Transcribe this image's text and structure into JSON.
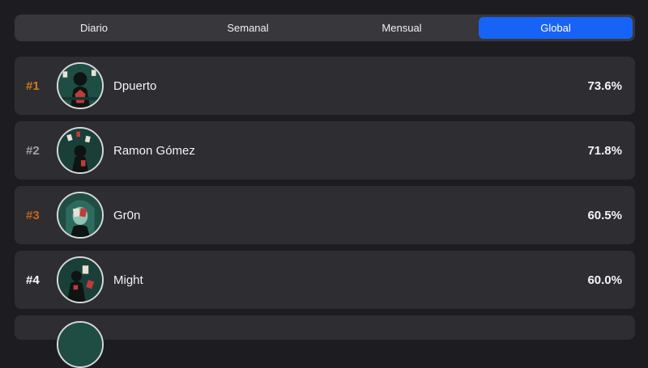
{
  "tabs": [
    {
      "label": "Diario",
      "active": false
    },
    {
      "label": "Semanal",
      "active": false
    },
    {
      "label": "Mensual",
      "active": false
    },
    {
      "label": "Global",
      "active": true
    }
  ],
  "leaderboard": [
    {
      "rank": "#1",
      "name": "Dpuerto",
      "score": "73.6%",
      "rank_color": "#d07a17",
      "avatar_icon": "player-avatar-icon"
    },
    {
      "rank": "#2",
      "name": "Ramon Gómez",
      "score": "71.8%",
      "rank_color": "#a0a0a6",
      "avatar_icon": "player-avatar-icon"
    },
    {
      "rank": "#3",
      "name": "Gr0n",
      "score": "60.5%",
      "rank_color": "#c8641c",
      "avatar_icon": "player-avatar-icon"
    },
    {
      "rank": "#4",
      "name": "Might",
      "score": "60.0%",
      "rank_color": "#ffffff",
      "avatar_icon": "player-avatar-icon"
    }
  ],
  "colors": {
    "background": "#1d1d21",
    "tab_bar": "#37373c",
    "active_tab": "#1763f6",
    "row": "#2d2d32"
  }
}
